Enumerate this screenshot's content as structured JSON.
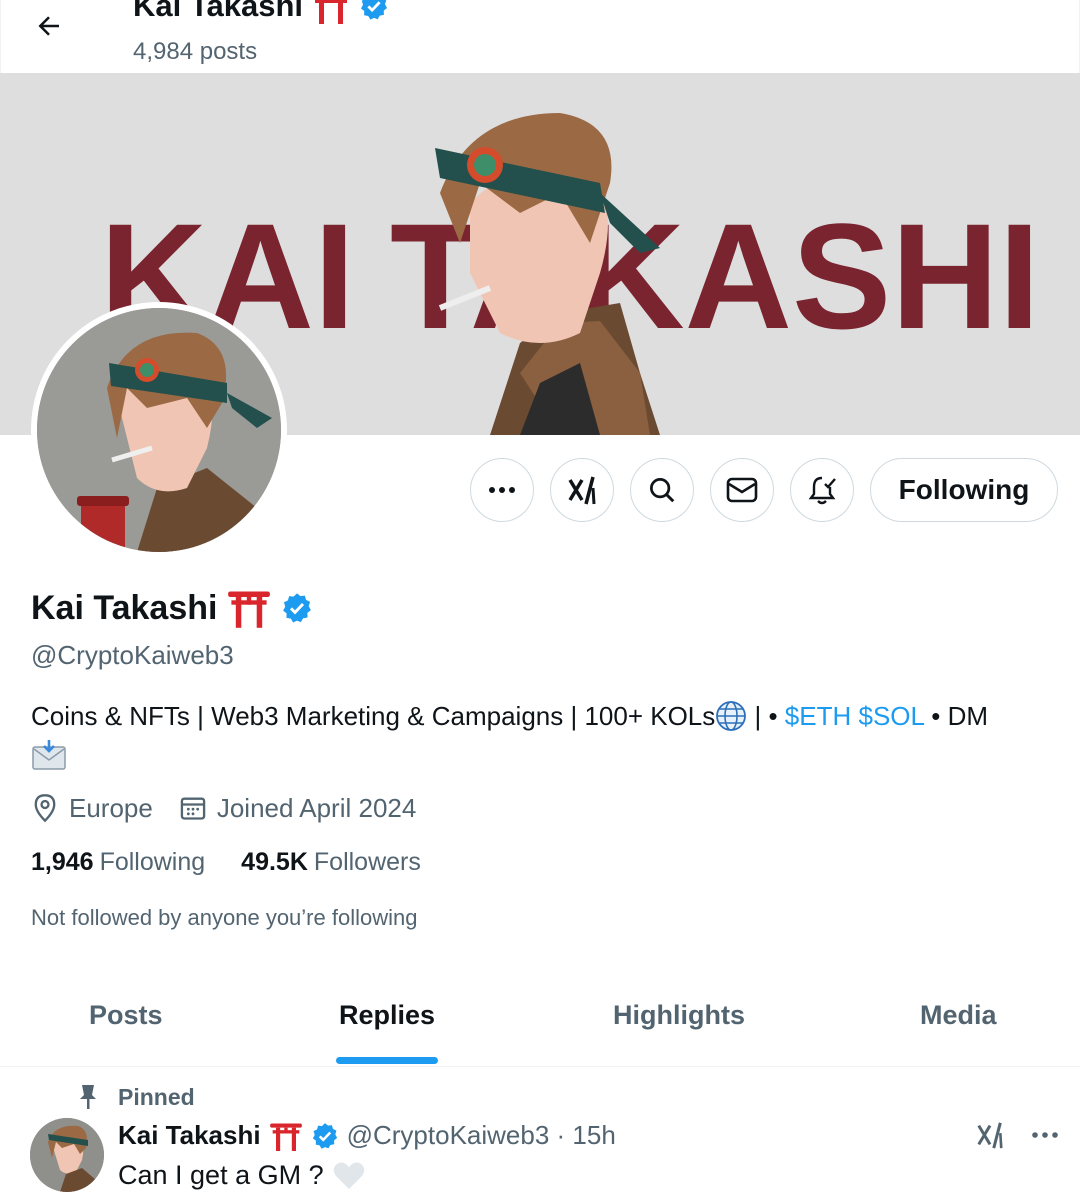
{
  "header": {
    "name": "Kai Takashi",
    "posts_count": "4,984 posts"
  },
  "banner": {
    "word1": "KAI",
    "word2": "TAKASHI"
  },
  "profile": {
    "display_name": "Kai Takashi",
    "handle": "@CryptoKaiweb3",
    "bio_prefix": "Coins & NFTs | Web3 Marketing & Campaigns | 100+ KOLs",
    "bio_sep": " | • ",
    "bio_tags": "$ETH $SOL",
    "bio_suffix": " • DM",
    "location": "Europe",
    "joined": "Joined April 2024",
    "following_count": "1,946",
    "following_label": "Following",
    "followers_count": "49.5K",
    "followers_label": "Followers",
    "not_followed": "Not followed by anyone you’re following"
  },
  "actions": {
    "following_button": "Following"
  },
  "tabs": [
    {
      "label": "Posts"
    },
    {
      "label": "Replies"
    },
    {
      "label": "Highlights"
    },
    {
      "label": "Media"
    }
  ],
  "pinned_post": {
    "pinned_label": "Pinned",
    "author": "Kai Takashi",
    "handle_time": "@CryptoKaiweb3 · 15h",
    "text": "Can I get a GM ?"
  },
  "colors": {
    "accent": "#1d9bf0",
    "banner_text": "#7a2430",
    "torii": "#d9262c",
    "verified": "#1d9bf0"
  }
}
